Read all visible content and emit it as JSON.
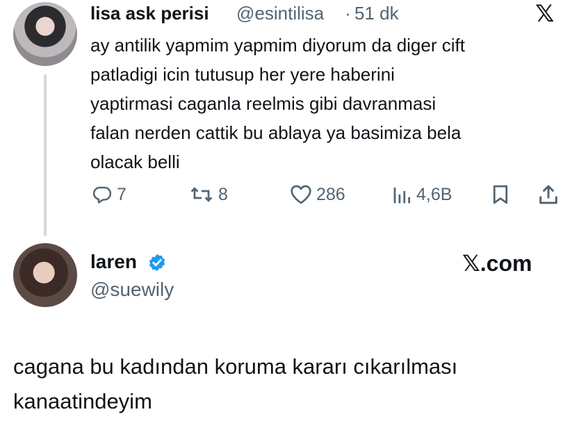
{
  "tweet1": {
    "name": "lisa ask perisi",
    "handle": "@esintilisa",
    "separator": "·",
    "time": "51 dk",
    "brand_logo": "𝕏",
    "text_lines": [
      "ay antilik yapmim yapmim diyorum da diger cift",
      "patladigi icin tutusup her yere haberini",
      "yaptirmasi caganla reelmis gibi davranmasi",
      "falan nerden cattik bu ablaya ya basimiza bela",
      "olacak belli"
    ],
    "actions": {
      "reply_count": "7",
      "retweet_count": "8",
      "like_count": "286",
      "views_count": "4,6B"
    }
  },
  "tweet2": {
    "name": "laren",
    "handle": "@suewily",
    "site_label": "𝕏.com",
    "text_lines": [
      "cagana bu kadından koruma kararı cıkarılması",
      "kanaatindeyim"
    ]
  },
  "colors": {
    "text": "#0f1419",
    "secondary": "#536471",
    "verified": "#1d9bf0",
    "thread_line": "#d4d9dd"
  },
  "icons": {
    "reply": "reply-icon",
    "retweet": "retweet-icon",
    "like": "heart-icon",
    "views": "views-icon",
    "bookmark": "bookmark-icon",
    "share": "share-icon",
    "verified": "verified-badge-icon",
    "logo": "x-logo-icon"
  }
}
